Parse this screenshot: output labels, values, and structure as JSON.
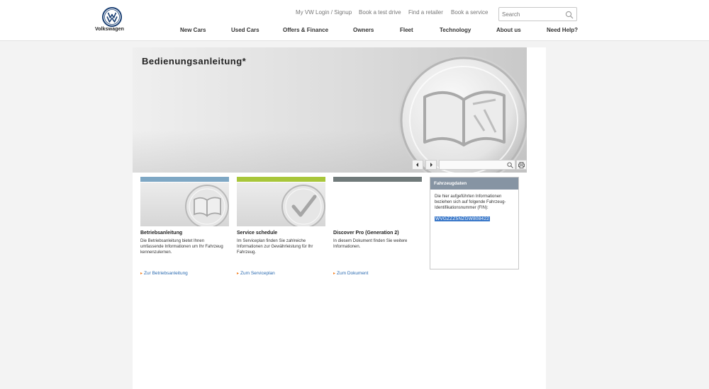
{
  "brand": {
    "name": "Volkswagen",
    "logo_icon": "vw-logo-icon"
  },
  "service_links": [
    {
      "label": "My VW Login / Signup"
    },
    {
      "label": "Book a test drive"
    },
    {
      "label": "Find a retailer"
    },
    {
      "label": "Book a service"
    }
  ],
  "search": {
    "placeholder": "Search",
    "value": "",
    "icon": "search-icon"
  },
  "main_nav": [
    {
      "label": "New Cars"
    },
    {
      "label": "Used Cars"
    },
    {
      "label": "Offers & Finance"
    },
    {
      "label": "Owners"
    },
    {
      "label": "Fleet"
    },
    {
      "label": "Technology"
    },
    {
      "label": "About us"
    },
    {
      "label": "Need Help?"
    }
  ],
  "hero": {
    "title": "Bedienungsanleitung*",
    "badge_icon": "book-icon",
    "controls": {
      "prev_icon": "arrow-left-icon",
      "next_icon": "arrow-right-icon",
      "search_icon": "search-icon",
      "print_icon": "print-icon",
      "search_value": ""
    }
  },
  "cards": [
    {
      "bar_color": "#7ea7c4",
      "icon": "book-icon",
      "title": "Betriebsanleitung",
      "text": "Die Betriebsanleitung bietet Ihnen umfassende Informationen um Ihr Fahrzeug kennenzulernen.",
      "link": "Zur Betriebsanleitung"
    },
    {
      "bar_color": "#a8c63a",
      "icon": "checkmark-icon",
      "title": "Service schedule",
      "text": "Im Serviceplan finden Sie zahlreiche Informationen zur Gewährleistung für Ihr Fahrzeug.",
      "link": "Zum Serviceplan"
    },
    {
      "bar_color": "#707a7a",
      "icon": "",
      "title": "Discover Pro (Generation 2)",
      "text": "In diesem Dokument finden Sie weitere Informationen.",
      "link": "Zum Dokument"
    }
  ],
  "vehicle_data": {
    "header": "Fahrzeugdaten",
    "text": "Die hier aufgeführten Informationen beziehen sich auf folgende Fahrzeug-Identifikationsnummer (FIN):",
    "vin": "WVGZZZ5NZGW808422",
    "header_color": "#8694a3",
    "highlight_color": "#3a78c9"
  },
  "colors": {
    "link": "#2a6ab0",
    "link_arrow": "#f47f20",
    "vw_blue": "#1a3f73"
  }
}
